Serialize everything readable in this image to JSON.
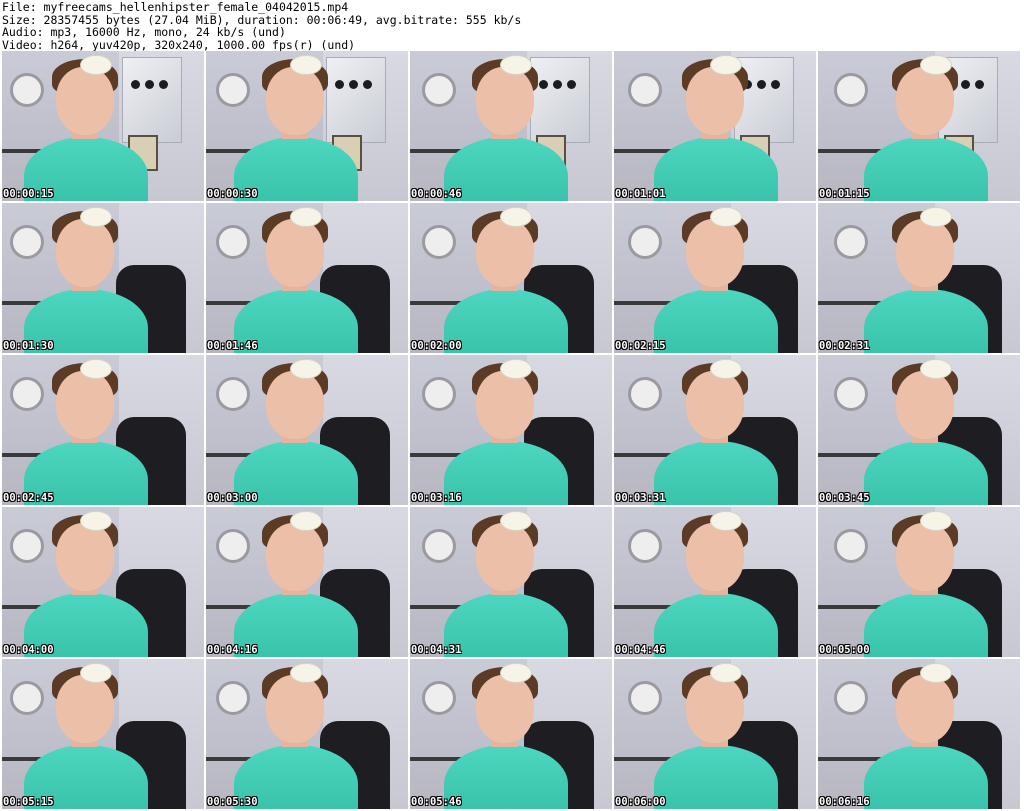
{
  "header": {
    "file": "File: myfreecams_hellenhipster_female_04042015.mp4",
    "size": "Size: 28357455 bytes (27.04 MiB), duration: 00:06:49, avg.bitrate: 555 kb/s",
    "audio": "Audio: mp3, 16000 Hz, mono, 24 kb/s (und)",
    "video": "Video: h264, yuv420p, 320x240, 1000.00 fps(r) (und)"
  },
  "thumbnails": [
    "00:00:15",
    "00:00:30",
    "00:00:46",
    "00:01:01",
    "00:01:15",
    "00:01:30",
    "00:01:46",
    "00:02:00",
    "00:02:15",
    "00:02:31",
    "00:02:45",
    "00:03:00",
    "00:03:16",
    "00:03:31",
    "00:03:45",
    "00:04:00",
    "00:04:16",
    "00:04:31",
    "00:04:46",
    "00:05:00",
    "00:05:15",
    "00:05:30",
    "00:05:46",
    "00:06:00",
    "00:06:16"
  ],
  "colors": {
    "shirt": "#3fcab1",
    "timestamp_text": "#ffffff",
    "background": "#ffffff"
  }
}
